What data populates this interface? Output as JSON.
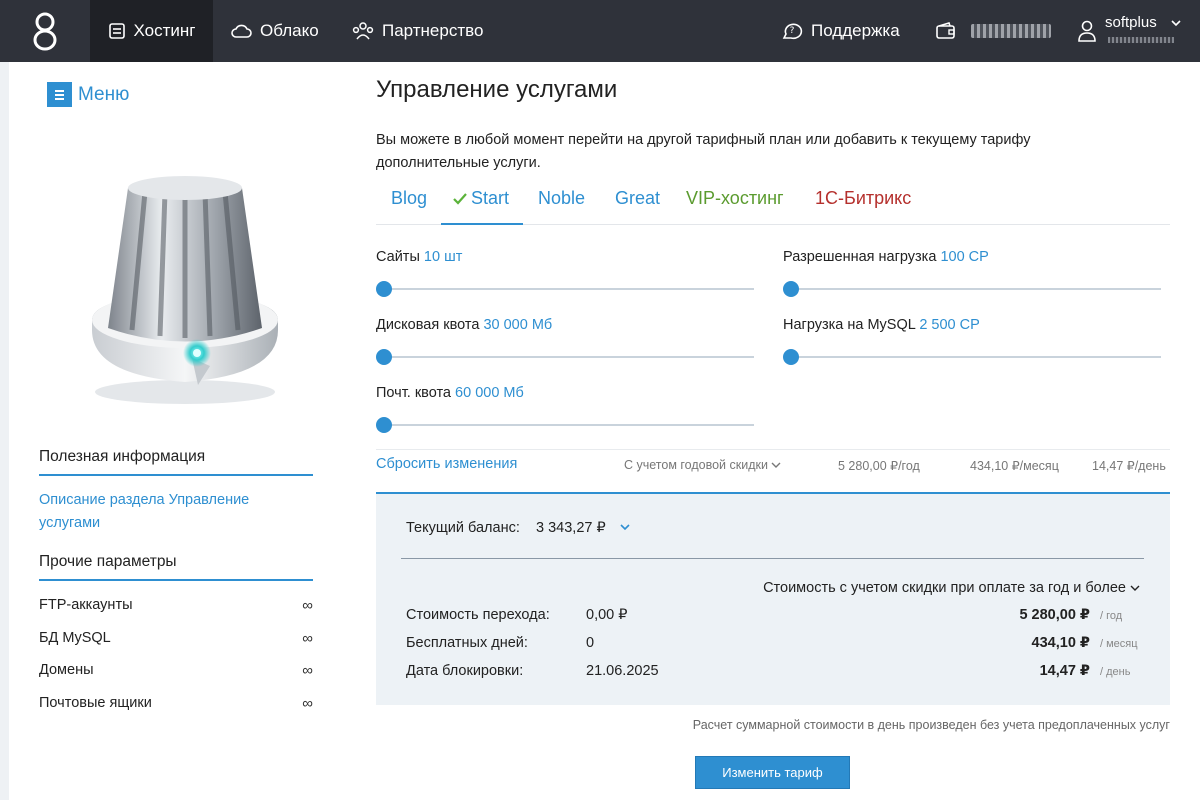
{
  "topnav": {
    "items": [
      {
        "label": "Хостинг",
        "icon": "server-icon",
        "active": true
      },
      {
        "label": "Облако",
        "icon": "cloud-icon"
      },
      {
        "label": "Партнерство",
        "icon": "partners-icon"
      }
    ],
    "support_label": "Поддержка",
    "username": "softplus"
  },
  "sidebar": {
    "menu_label": "Меню",
    "useful_info_title": "Полезная информация",
    "useful_link": "Описание раздела Управление услугами",
    "other_params_title": "Прочие параметры",
    "params": [
      {
        "label": "FTP-аккаунты",
        "value": "∞"
      },
      {
        "label": "БД MySQL",
        "value": "∞"
      },
      {
        "label": "Домены",
        "value": "∞"
      },
      {
        "label": "Почтовые ящики",
        "value": "∞"
      }
    ]
  },
  "main": {
    "title": "Управление услугами",
    "description": "Вы можете в любой момент перейти на другой тарифный план или добавить к текущему тарифу дополнительные услуги.",
    "tabs": [
      {
        "label": "Blog",
        "color": "#2e8fd1",
        "active": false
      },
      {
        "label": "Start",
        "color": "#2e8fd1",
        "active": true
      },
      {
        "label": "Noble",
        "color": "#2e8fd1",
        "active": false
      },
      {
        "label": "Great",
        "color": "#2e8fd1",
        "active": false
      },
      {
        "label": "VIP-хостинг",
        "color": "#5b9b2f",
        "active": false
      },
      {
        "label": "1С-Битрикс",
        "color": "#b5302d",
        "active": false
      }
    ],
    "sliders": [
      {
        "label": "Сайты",
        "value": "10 шт",
        "level": 0
      },
      {
        "label": "Разрешенная нагрузка",
        "value": "100 CP",
        "level": 0
      },
      {
        "label": "Дисковая квота",
        "value": "30 000 Мб",
        "level": 0
      },
      {
        "label": "Нагрузка на MySQL",
        "value": "2 500 CP",
        "level": 0
      },
      {
        "label": "Почт. квота",
        "value": "60 000 Мб",
        "level": 0
      }
    ],
    "reset_label": "Сбросить изменения",
    "discount_label": "С учетом годовой скидки",
    "price_year": "5 280,00 ₽/год",
    "price_month": "434,10 ₽/месяц",
    "price_day": "14,47 ₽/день"
  },
  "panel": {
    "balance_label": "Текущий баланс:",
    "balance_value": "3 343,27 ₽",
    "cost_title": "Стоимость с учетом скидки при оплате за год и более",
    "rows": [
      {
        "label": "Стоимость перехода:",
        "value": "0,00 ₽",
        "price": "5 280,00 ₽",
        "unit": "/ год"
      },
      {
        "label": "Бесплатных дней:",
        "value": "0",
        "price": "434,10 ₽",
        "unit": "/ месяц"
      },
      {
        "label": "Дата блокировки:",
        "value": "21.06.2025",
        "price": "14,47 ₽",
        "unit": "/ день"
      }
    ]
  },
  "footnote": "Расчет суммарной стоимости в день произведен без учета предоплаченных услуг",
  "submit_label": "Изменить тариф",
  "colors": {
    "accent": "#2e8fd1",
    "topbar": "#2f323a",
    "vip": "#5b9b2f",
    "bitrix": "#b5302d"
  }
}
